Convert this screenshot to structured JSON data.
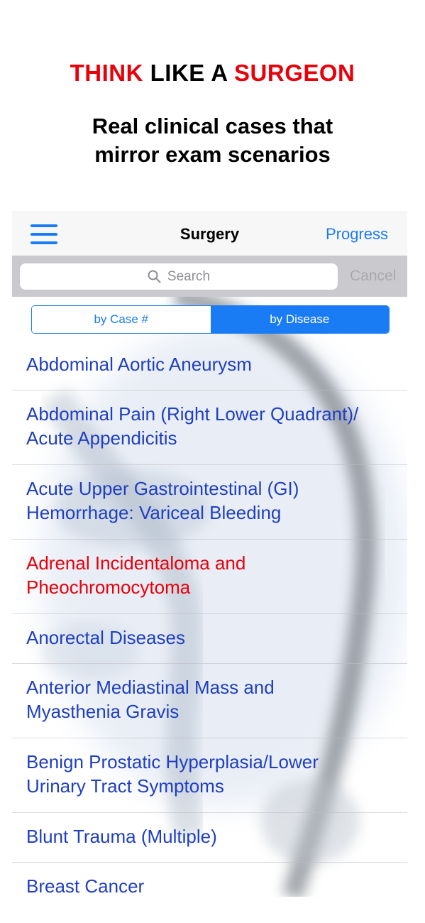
{
  "promo": {
    "title_part1": "THINK",
    "title_part2": " LIKE A ",
    "title_part3": "SURGEON",
    "subtitle_line1": "Real clinical cases that",
    "subtitle_line2": "mirror exam scenarios"
  },
  "navbar": {
    "title": "Surgery",
    "progress_label": "Progress",
    "menu_icon": "hamburger-menu-icon"
  },
  "search": {
    "placeholder": "Search",
    "cancel_label": "Cancel",
    "icon": "search-icon"
  },
  "segments": {
    "items": [
      {
        "label": "by Case #",
        "selected": false
      },
      {
        "label": "by Disease",
        "selected": true
      }
    ]
  },
  "cases": [
    {
      "line1": "Abdominal Aortic Aneurysm",
      "line2": "",
      "highlighted": false
    },
    {
      "line1": "Abdominal Pain (Right Lower Quadrant)/",
      "line2": "Acute Appendicitis",
      "highlighted": false
    },
    {
      "line1": "Acute Upper Gastrointestinal (GI)",
      "line2": "Hemorrhage: Variceal Bleeding",
      "highlighted": false
    },
    {
      "line1": "Adrenal Incidentaloma and",
      "line2": "Pheochromocytoma",
      "highlighted": true
    },
    {
      "line1": "Anorectal Diseases",
      "line2": "",
      "highlighted": false
    },
    {
      "line1": "Anterior Mediastinal Mass and",
      "line2": "Myasthenia Gravis",
      "highlighted": false
    },
    {
      "line1": "Benign Prostatic Hyperplasia/Lower",
      "line2": "Urinary Tract Symptoms",
      "highlighted": false
    },
    {
      "line1": "Blunt Trauma (Multiple)",
      "line2": "",
      "highlighted": false
    },
    {
      "line1": "Breast Cancer",
      "line2": "",
      "highlighted": false
    }
  ],
  "colors": {
    "accent": "#1a7cf5",
    "list_text": "#1f3fc1",
    "highlight": "#e8000a"
  },
  "background_art": "stethoscope-image"
}
